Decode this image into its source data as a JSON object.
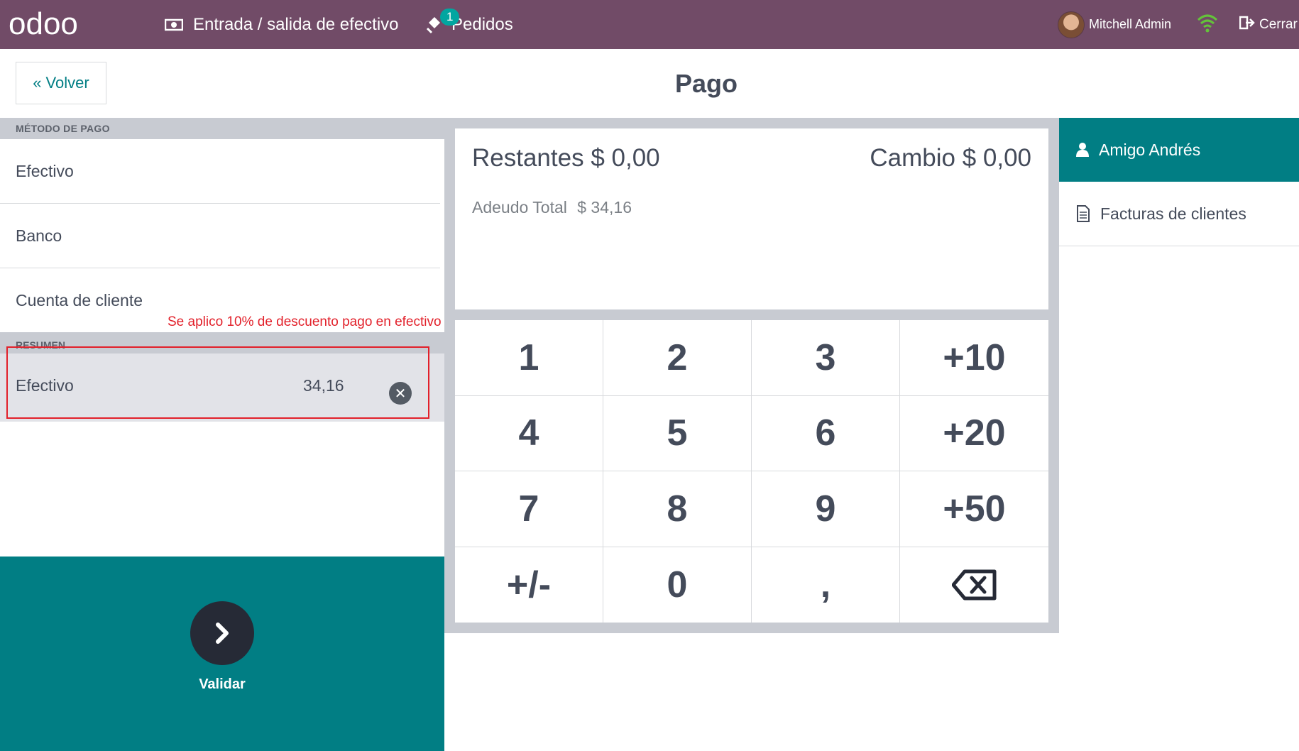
{
  "brand": {
    "logo_text": "odoo"
  },
  "topbar": {
    "cash_in_out": "Entrada / salida de efectivo",
    "orders_label": "Pedidos",
    "orders_badge": "1",
    "user_name": "Mitchell Admin",
    "close_label": "Cerrar",
    "icons": [
      "cash-icon",
      "orders-icon",
      "wifi-icon",
      "logout-icon"
    ]
  },
  "header": {
    "back_label": "Volver",
    "title": "Pago"
  },
  "payment_methods": {
    "section_label": "MÉTODO DE PAGO",
    "items": [
      {
        "label": "Efectivo"
      },
      {
        "label": "Banco"
      },
      {
        "label": "Cuenta de cliente"
      }
    ]
  },
  "summary": {
    "section_label": "RESUMEN",
    "lines": [
      {
        "method": "Efectivo",
        "amount": "34,16"
      }
    ]
  },
  "annotation": {
    "text": "Se aplico 10% de descuento pago en efectivo",
    "color": "#e2202a"
  },
  "totals": {
    "remaining_label": "Restantes",
    "remaining_value": "$ 0,00",
    "change_label": "Cambio",
    "change_value": "$ 0,00",
    "total_due_label": "Adeudo Total",
    "total_due_value": "$ 34,16"
  },
  "numpad": {
    "keys": [
      "1",
      "2",
      "3",
      "+10",
      "4",
      "5",
      "6",
      "+20",
      "7",
      "8",
      "9",
      "+50",
      "+/-",
      "0",
      ",",
      "⌫"
    ]
  },
  "validate": {
    "label": "Validar"
  },
  "sidebar_right": {
    "customer": "Amigo Andrés",
    "invoices": "Facturas de clientes"
  },
  "colors": {
    "topbar": "#714b67",
    "accent": "#017e84",
    "badge": "#01a6a0",
    "panel_bg": "#c8cbd2",
    "validate_circle": "#262a36"
  }
}
